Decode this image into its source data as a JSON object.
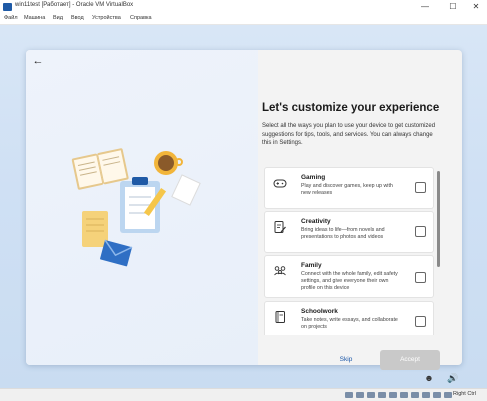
{
  "window": {
    "title": "win11test [Работает] - Oracle VM VirtualBox",
    "controls": [
      "—",
      "☐",
      "✕"
    ]
  },
  "menu": [
    "Файл",
    "Машина",
    "Вид",
    "Ввод",
    "Устройства",
    "Справка"
  ],
  "oobe": {
    "back_glyph": "←",
    "heading": "Let's customize your experience",
    "subtext": "Select all the ways you plan to use your device to get customized suggestions for tips, tools, and services. You can always change this in Settings.",
    "options": [
      {
        "icon": "gamepad-icon",
        "title": "Gaming",
        "desc": "Play and discover games, keep up with new releases",
        "checked": false
      },
      {
        "icon": "document-pen-icon",
        "title": "Creativity",
        "desc": "Bring ideas to life—from novels and presentations to photos and videos",
        "checked": false
      },
      {
        "icon": "people-icon",
        "title": "Family",
        "desc": "Connect with the whole family, edit safety settings, and give everyone their own profile on this device",
        "checked": false
      },
      {
        "icon": "notebook-icon",
        "title": "Schoolwork",
        "desc": "Take notes, write essays, and collaborate on projects",
        "checked": false
      }
    ],
    "skip_label": "Skip",
    "accept_label": "Accept"
  },
  "status": {
    "host_key": "Right Ctrl"
  },
  "colors": {
    "accent": "#1a56a8",
    "background": "#cfe0f4"
  }
}
